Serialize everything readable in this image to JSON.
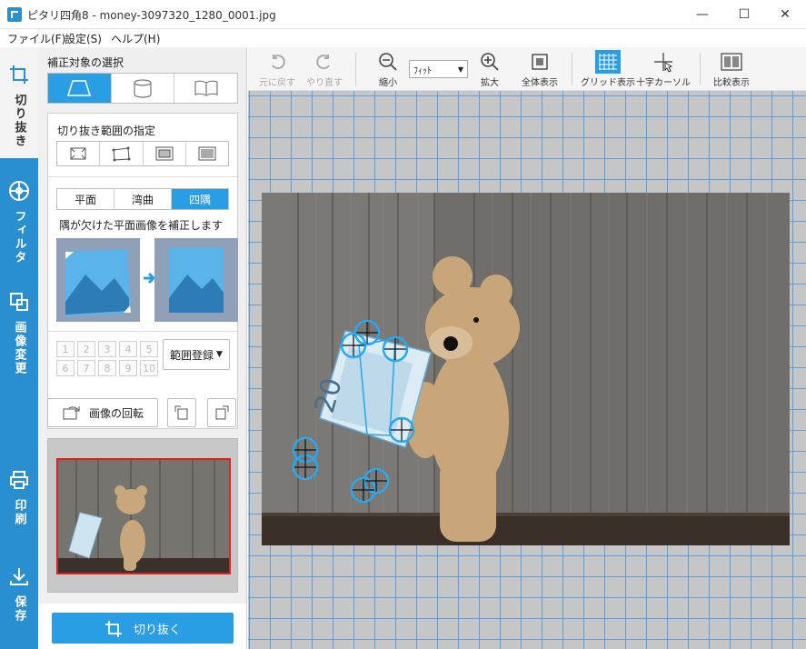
{
  "window": {
    "title": "ピタリ四角8 - money-3097320_1280_0001.jpg",
    "minimize": "—",
    "maximize": "☐",
    "close": "✕"
  },
  "menu": [
    "ファイル(F)",
    "設定(S)",
    "ヘルプ(H)"
  ],
  "rail": {
    "tabs": [
      {
        "icon": "crop-icon",
        "label": "切り抜き"
      },
      {
        "icon": "filter-icon",
        "label": "フィルタ"
      },
      {
        "icon": "image-resize-icon",
        "label": "画像変更"
      },
      {
        "icon": "printer-icon",
        "label": "印刷"
      },
      {
        "icon": "download-icon",
        "label": "保存"
      }
    ]
  },
  "panel": {
    "target_title": "補正対象の選択",
    "range_title": "切り抜き範囲の指定",
    "modes": [
      "平面",
      "湾曲",
      "四隅"
    ],
    "active_mode": "四隅",
    "description": "隅が欠けた平面画像を補正します",
    "slots": [
      "1",
      "2",
      "3",
      "4",
      "5",
      "6",
      "7",
      "8",
      "9",
      "10"
    ],
    "register_label": "範囲登録",
    "rotate_label": "画像の回転",
    "crop_button": "切り抜く"
  },
  "toolbar": {
    "undo": "元に戻す",
    "redo": "やり直す",
    "zoom_out": "縮小",
    "zoom_select": "ﾌｨｯﾄ",
    "zoom_in": "拡大",
    "fit_all": "全体表示",
    "grid": "グリッド表示",
    "crosshair": "十字カーソル",
    "compare": "比較表示"
  },
  "colors": {
    "accent": "#2a9ee4",
    "rail": "#2a8fd0",
    "grid_line": "#5aa0e0",
    "preview_border": "#e02020"
  }
}
